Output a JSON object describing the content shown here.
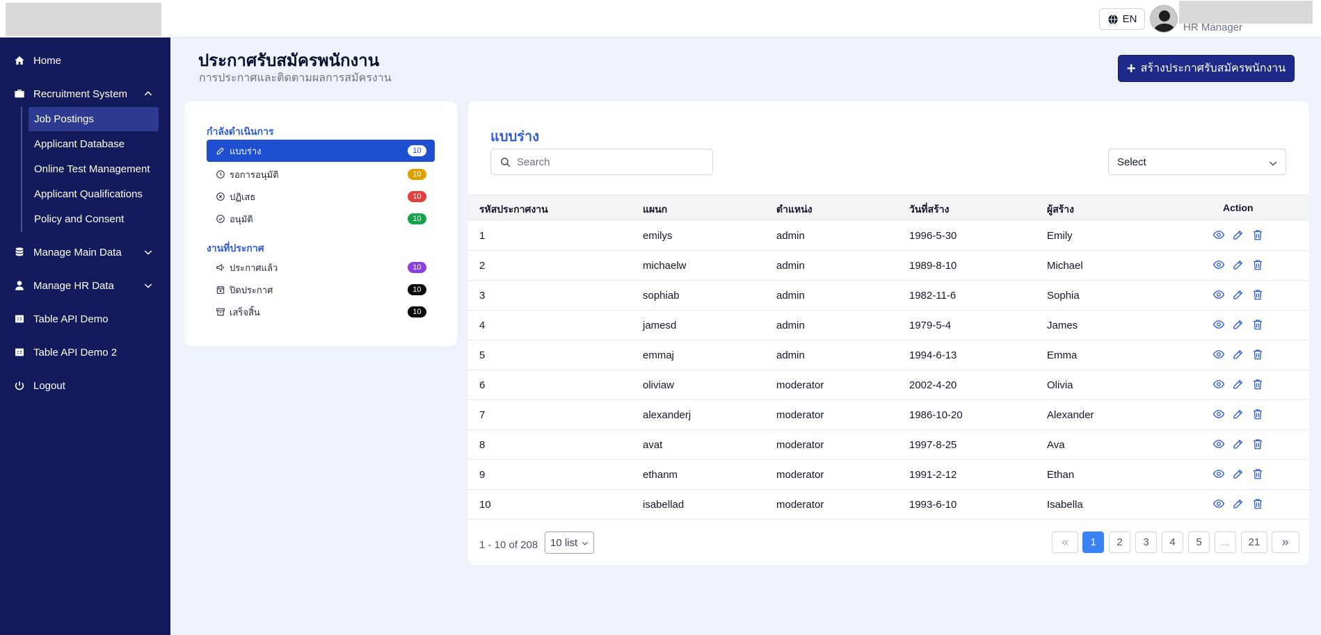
{
  "header": {
    "language": "EN",
    "user_role": "HR Manager"
  },
  "sidebar": {
    "items": [
      {
        "label": "Home",
        "icon": "home-icon"
      },
      {
        "label": "Recruitment System",
        "icon": "briefcase-icon"
      },
      {
        "label": "Manage Main Data",
        "icon": "database-icon"
      },
      {
        "label": "Manage HR Data",
        "icon": "user-icon"
      },
      {
        "label": "Table API Demo",
        "icon": "csv-icon"
      },
      {
        "label": "Table API Demo 2",
        "icon": "csv-icon"
      },
      {
        "label": "Logout",
        "icon": "power-icon"
      }
    ],
    "sub_items": [
      {
        "label": "Job Postings",
        "active": true
      },
      {
        "label": "Applicant Database"
      },
      {
        "label": "Online Test Management"
      },
      {
        "label": "Applicant Qualifications"
      },
      {
        "label": "Policy and Consent"
      }
    ]
  },
  "page": {
    "title": "ประกาศรับสมัครพนักงาน",
    "subtitle": "การประกาศและติดตามผลการสมัครงาน",
    "create_button": "สร้างประกาศรับสมัครพนักงาน"
  },
  "status_panel": {
    "group1_label": "กำลังดำเนินการ",
    "group2_label": "งานที่ประกาศ",
    "items": [
      {
        "label": "แบบร่าง",
        "count": "10",
        "color": "#ffffff",
        "icon": "pencil-icon",
        "active": true
      },
      {
        "label": "รอการอนุมัติ",
        "count": "10",
        "color": "#e0a000",
        "icon": "clock-icon"
      },
      {
        "label": "ปฏิเสธ",
        "count": "10",
        "color": "#e53e3e",
        "icon": "x-circle-icon"
      },
      {
        "label": "อนุมัติ",
        "count": "10",
        "color": "#16a34a",
        "icon": "check-circle-icon"
      },
      {
        "label": "ประกาศแล้ว",
        "count": "10",
        "color": "#8b3fe0",
        "icon": "megaphone-icon"
      },
      {
        "label": "ปิดประกาศ",
        "count": "10",
        "color": "#0a0a0a",
        "icon": "calendar-x-icon"
      },
      {
        "label": "เสร็จสิ้น",
        "count": "10",
        "color": "#0a0a0a",
        "icon": "archive-icon"
      }
    ]
  },
  "table": {
    "title": "แบบร่าง",
    "search_placeholder": "Search",
    "select_value": "Select",
    "columns": [
      "รหัสประกาศงาน",
      "แผนก",
      "ตำแหน่ง",
      "วันที่สร้าง",
      "ผู้สร้าง",
      "Action"
    ],
    "rows": [
      [
        "1",
        "emilys",
        "admin",
        "1996-5-30",
        "Emily"
      ],
      [
        "2",
        "michaelw",
        "admin",
        "1989-8-10",
        "Michael"
      ],
      [
        "3",
        "sophiab",
        "admin",
        "1982-11-6",
        "Sophia"
      ],
      [
        "4",
        "jamesd",
        "admin",
        "1979-5-4",
        "James"
      ],
      [
        "5",
        "emmaj",
        "admin",
        "1994-6-13",
        "Emma"
      ],
      [
        "6",
        "oliviaw",
        "moderator",
        "2002-4-20",
        "Olivia"
      ],
      [
        "7",
        "alexanderj",
        "moderator",
        "1986-10-20",
        "Alexander"
      ],
      [
        "8",
        "avat",
        "moderator",
        "1997-8-25",
        "Ava"
      ],
      [
        "9",
        "ethanm",
        "moderator",
        "1991-2-12",
        "Ethan"
      ],
      [
        "10",
        "isabellad",
        "moderator",
        "1993-6-10",
        "Isabella"
      ]
    ]
  },
  "pagination": {
    "info": "1 - 10 of 208",
    "per_page": "10 list",
    "pages": [
      "1",
      "2",
      "3",
      "4",
      "5",
      "...",
      "21"
    ],
    "current": "1"
  },
  "colors": {
    "sidebar_bg": "#141b5c",
    "primary": "#1e2a8a",
    "accent": "#2f5bd8",
    "active_status": "#1f4fd1",
    "active_page": "#3b82f6"
  }
}
